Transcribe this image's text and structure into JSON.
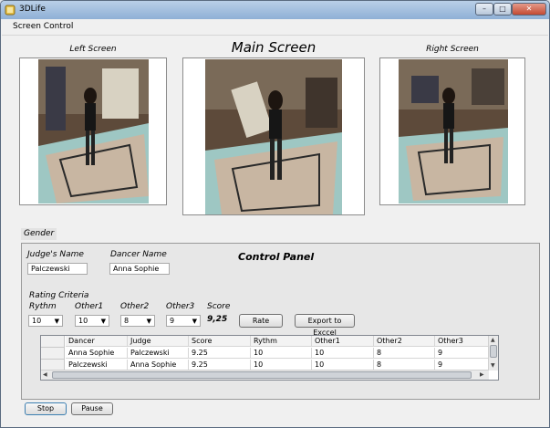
{
  "window": {
    "title": "3DLife",
    "min_glyph": "–",
    "max_glyph": "□",
    "close_glyph": "✕"
  },
  "menu": {
    "screen_control": "Screen Control"
  },
  "screens": {
    "left_label": "Left Screen",
    "main_label": "Main Screen",
    "right_label": "Right Screen"
  },
  "gender_label": "Gender",
  "control_panel": {
    "title": "Control Panel",
    "judge_name_label": "Judge's Name",
    "judge_name_value": "Palczewski",
    "dancer_name_label": "Dancer Name",
    "dancer_name_value": "Anna Sophie",
    "rating_criteria_label": "Rating Criteria",
    "criteria": {
      "rythm_label": "Rythm",
      "rythm_value": "10",
      "other1_label": "Other1",
      "other1_value": "10",
      "other2_label": "Other2",
      "other2_value": "8",
      "other3_label": "Other3",
      "other3_value": "9",
      "score_label": "Score",
      "score_value": "9,25"
    },
    "rate_button": "Rate",
    "export_button": "Export to Exccel"
  },
  "grid": {
    "columns": [
      "Dancer",
      "Judge",
      "Score",
      "Rythm",
      "Other1",
      "Other2",
      "Other3"
    ],
    "rows": [
      [
        "Anna Sophie",
        "Palczewski",
        "9.25",
        "10",
        "10",
        "8",
        "9"
      ],
      [
        "Palczewski",
        "Anna Sophie",
        "9.25",
        "10",
        "10",
        "8",
        "9"
      ]
    ]
  },
  "buttons": {
    "stop": "Stop",
    "pause": "Pause"
  },
  "colors": {
    "title_bar": "#8fb0d6",
    "close_button": "#c34a33",
    "panel_bg": "#e7e7e7",
    "floor_mat": "#c9b7a4",
    "floor_glow": "#d9f2ee"
  }
}
